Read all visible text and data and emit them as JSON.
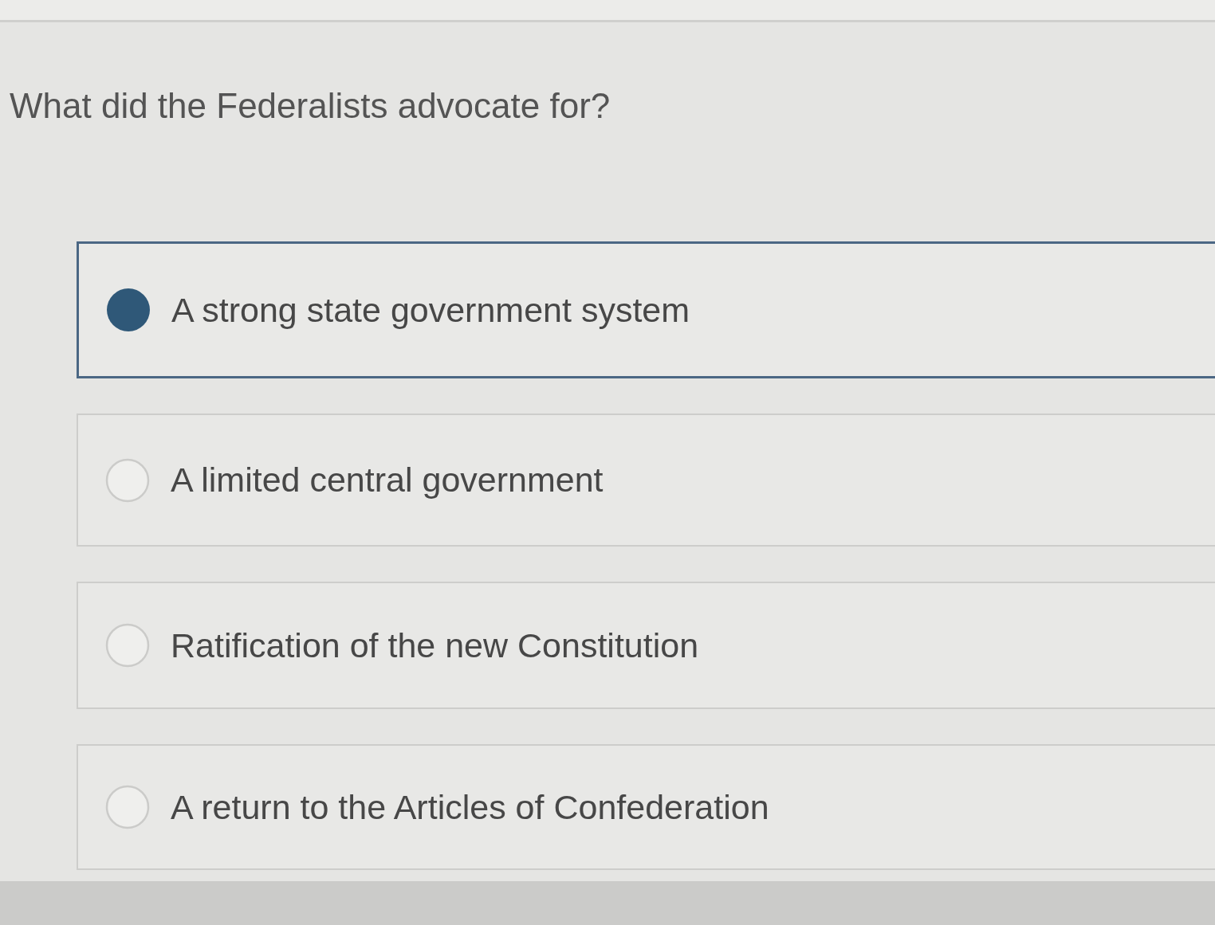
{
  "question": {
    "text": "What did the Federalists advocate for?"
  },
  "options": [
    {
      "label": "A strong state government system",
      "selected": true
    },
    {
      "label": "A limited central government",
      "selected": false
    },
    {
      "label": "Ratification of the new Constitution",
      "selected": false
    },
    {
      "label": "A return to the Articles of Confederation",
      "selected": false
    }
  ]
}
